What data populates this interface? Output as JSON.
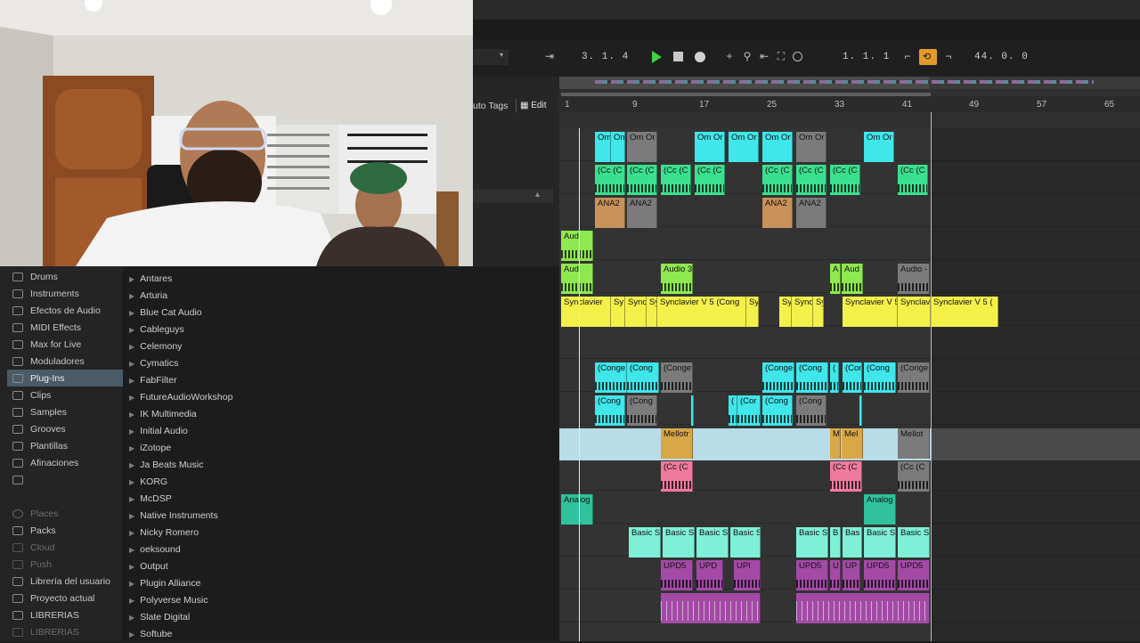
{
  "transport": {
    "arrangement_position": "3.   1.   4",
    "loop_start": "1.   1.   1",
    "loop_length": "44.   0.   0"
  },
  "browser": {
    "tags_label": "uto Tags",
    "edit_label": "Edit",
    "categories": [
      {
        "label": "Drums"
      },
      {
        "label": "Instruments"
      },
      {
        "label": "Efectos de Audio"
      },
      {
        "label": "MIDI Effects"
      },
      {
        "label": "Max for Live"
      },
      {
        "label": "Moduladores"
      },
      {
        "label": "Plug-Ins",
        "selected": true
      },
      {
        "label": "Clips"
      },
      {
        "label": "Samples"
      },
      {
        "label": "Grooves"
      },
      {
        "label": "Plantillas"
      },
      {
        "label": "Afinaciones"
      },
      {
        "label": ""
      }
    ],
    "places_header": "Places",
    "places": [
      "Packs",
      "Cloud",
      "Push",
      "Librería del usuario",
      "Proyecto actual",
      "LIBRERIAS",
      "LIBRERIAS"
    ],
    "plugins": [
      "Antares",
      "Arturia",
      "Blue Cat Audio",
      "Cableguys",
      "Celemony",
      "Cymatics",
      "FabFilter",
      "FutureAudioWorkshop",
      "IK Multimedia",
      "Initial Audio",
      "iZotope",
      "Ja Beats Music",
      "KORG",
      "McDSP",
      "Native Instruments",
      "Nicky Romero",
      "oeksound",
      "Output",
      "Plugin Alliance",
      "Polyverse Music",
      "Slate Digital",
      "Softube"
    ]
  },
  "ruler": [
    "1",
    "9",
    "17",
    "25",
    "33",
    "41",
    "49",
    "57",
    "65"
  ],
  "colors": {
    "cyan": "#3fe6ea",
    "green": "#3be08f",
    "orange": "#c8925a",
    "lime": "#8ee84f",
    "yellow": "#f3f04a",
    "gold": "#d8a746",
    "pink": "#ef7a9e",
    "teal": "#2fc29c",
    "mint": "#7ff0d8",
    "purple": "#a24aa5",
    "gray": "#7b7b7b",
    "selection": "#b8dce8"
  },
  "clips": {
    "om": "Om",
    "om_or": "Om Or",
    "cc": "(Cc",
    "cc_paren": "(Cc (C",
    "ana2": "ANA2",
    "aud": "Aud",
    "audio3": "Audio 3",
    "audio_dash": "Audio -",
    "a": "A",
    "syn_full": "Synclavier V 5 (Cong",
    "syn_full2": "Synclavier V 5 (",
    "syn_short": "Sy",
    "sync": "Sync",
    "synclav": "Synclav",
    "syn_a": "Synclavier",
    "conge": "(Conge",
    "cong": "(Cong",
    "c": "(",
    "mellotr": "Mellotr",
    "m": "M",
    "mel": "Mel",
    "mellot": "Mellot",
    "cc_cc": "(Cc (C",
    "cc_gray": "(Cc (C",
    "cor": "(Cor",
    "analog": "Analog",
    "basic": "Basic S",
    "basic_b": "B",
    "basic_bas": "Bas",
    "upd5": "UPD5",
    "upd": "UPD",
    "upi": "UPI",
    "u": "U",
    "up": "UP"
  }
}
